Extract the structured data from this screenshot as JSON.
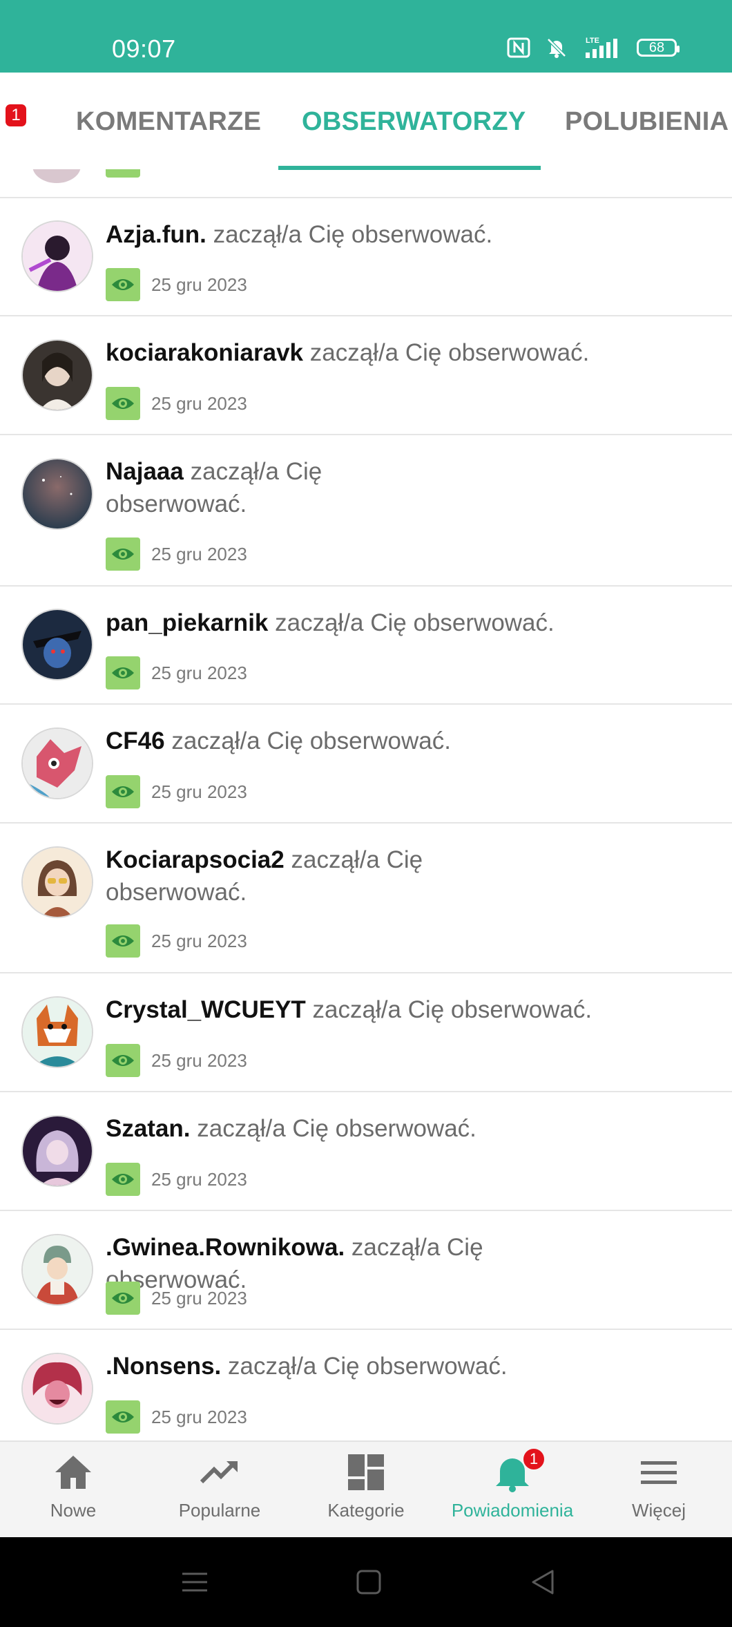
{
  "status_bar": {
    "time": "09:07",
    "battery": "68",
    "icons": [
      "nfc-icon",
      "mute-icon",
      "lte-signal-icon",
      "battery-icon"
    ]
  },
  "tabs": {
    "badge": "1",
    "items": [
      {
        "label": "KOMENTARZE",
        "active": false
      },
      {
        "label": "OBSERWATORZY",
        "active": true
      },
      {
        "label": "POLUBIENIA",
        "active": false
      }
    ]
  },
  "notifications": [
    {
      "username": "Azja.fun.",
      "action": "zaczął/a Cię obserwować.",
      "date": "25 gru 2023",
      "avatar_color": "#c060a0"
    },
    {
      "username": "kociarakoniaravk",
      "action": "zaczął/a Cię obserwować.",
      "date": "25 gru 2023",
      "avatar_color": "#3a3430"
    },
    {
      "username": "Najaaa",
      "action": "zaczął/a Cię",
      "action_line2": "obserwować.",
      "date": "25 gru 2023",
      "avatar_color": "#3c4b5a"
    },
    {
      "username": "pan_piekarnik",
      "action": "zaczął/a Cię obserwować.",
      "date": "25 gru 2023",
      "avatar_color": "#1c2a40"
    },
    {
      "username": "CF46",
      "action": "zaczął/a Cię obserwować.",
      "date": "25 gru 2023",
      "avatar_color": "#d8566e"
    },
    {
      "username": "Kociarapsocia2",
      "action": "zaczął/a Cię",
      "action_line2": "obserwować.",
      "date": "25 gru 2023",
      "avatar_color": "#a27a5f"
    },
    {
      "username": "Crystal_WCUEYT",
      "action": "zaczął/a Cię obserwować.",
      "date": "25 gru 2023",
      "avatar_color": "#d86a2a"
    },
    {
      "username": "Szatan.",
      "action": "zaczął/a Cię obserwować.",
      "date": "25 gru 2023",
      "avatar_color": "#5a3a6e"
    },
    {
      "username": ".Gwinea.Rownikowa.",
      "action": "zaczął/a Cię obserwować.",
      "date": "25 gru 2023",
      "avatar_color": "#8fb3a8"
    },
    {
      "username": ".Nonsens.",
      "action": "zaczął/a Cię obserwować.",
      "date": "25 gru 2023",
      "avatar_color": "#b3304a"
    }
  ],
  "bottom_nav": {
    "badge": "1",
    "items": [
      {
        "label": "Nowe",
        "icon": "home-icon",
        "active": false
      },
      {
        "label": "Popularne",
        "icon": "trending-icon",
        "active": false
      },
      {
        "label": "Kategorie",
        "icon": "categories-icon",
        "active": false
      },
      {
        "label": "Powiadomienia",
        "icon": "bell-icon",
        "active": true
      },
      {
        "label": "Więcej",
        "icon": "menu-icon",
        "active": false
      }
    ]
  },
  "colors": {
    "accent": "#2fb39a",
    "chip_green": "#95d36e",
    "badge_red": "#e3121b"
  }
}
